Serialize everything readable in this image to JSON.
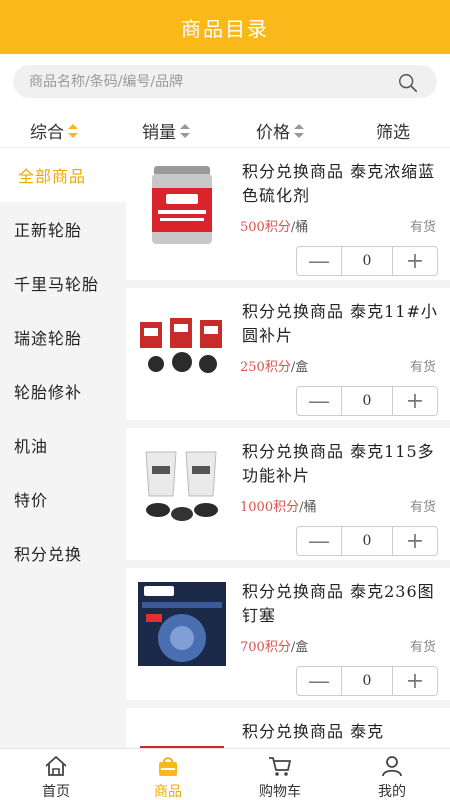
{
  "header": {
    "title": "商品目录"
  },
  "search": {
    "placeholder": "商品名称/条码/编号/品牌"
  },
  "sort": {
    "comprehensive": "综合",
    "sales": "销量",
    "price": "价格",
    "filter": "筛选"
  },
  "sidebar": {
    "items": [
      {
        "label": "全部商品"
      },
      {
        "label": "正新轮胎"
      },
      {
        "label": "千里马轮胎"
      },
      {
        "label": "瑞途轮胎"
      },
      {
        "label": "轮胎修补"
      },
      {
        "label": "机油"
      },
      {
        "label": "特价"
      },
      {
        "label": "积分兑换"
      }
    ]
  },
  "products": [
    {
      "name": "积分兑换商品 泰克浓缩蓝色硫化剂",
      "points": "500积分",
      "unit": "/桶",
      "stock": "有货",
      "qty": "0"
    },
    {
      "name": "积分兑换商品 泰克11#小圆补片",
      "points": "250积分",
      "unit": "/盒",
      "stock": "有货",
      "qty": "0"
    },
    {
      "name": "积分兑换商品 泰克115多功能补片",
      "points": "1000积分",
      "unit": "/桶",
      "stock": "有货",
      "qty": "0"
    },
    {
      "name": "积分兑换商品 泰克236图钉塞",
      "points": "700积分",
      "unit": "/盒",
      "stock": "有货",
      "qty": "0"
    },
    {
      "name": "积分兑换商品 泰克",
      "points": "",
      "unit": "",
      "stock": "",
      "qty": ""
    }
  ],
  "stepper": {
    "minus": "—",
    "plus": "+"
  },
  "tabbar": {
    "home": "首页",
    "products": "商品",
    "cart": "购物车",
    "mine": "我的"
  },
  "colors": {
    "accent": "#fbb81b",
    "price": "#d9534f"
  }
}
